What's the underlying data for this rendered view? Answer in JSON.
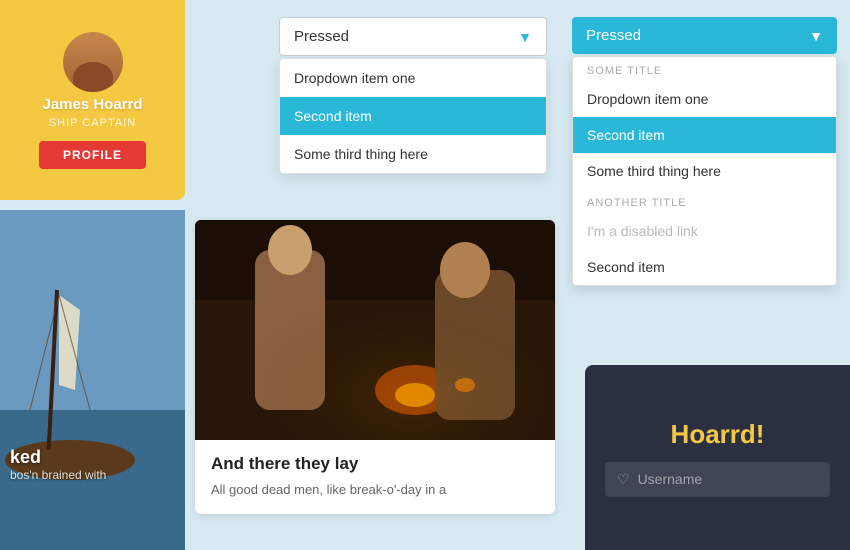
{
  "profile": {
    "name": "James Hoarrd",
    "title": "SHIP CAPTAIN",
    "button_label": "PROFILE"
  },
  "dropdown_simple": {
    "trigger_label": "Pressed",
    "items": [
      {
        "label": "Dropdown item one",
        "active": false
      },
      {
        "label": "Second item",
        "active": true
      },
      {
        "label": "Some third thing here",
        "active": false
      }
    ]
  },
  "dropdown_fancy": {
    "trigger_label": "Pressed",
    "sections": [
      {
        "title": "SOME TITLE",
        "items": [
          {
            "label": "Dropdown item one",
            "active": false,
            "disabled": false
          },
          {
            "label": "Second item",
            "active": true,
            "disabled": false
          },
          {
            "label": "Some third thing here",
            "active": false,
            "disabled": false
          }
        ]
      },
      {
        "title": "ANOTHER TITLE",
        "items": [
          {
            "label": "I'm a disabled link",
            "active": false,
            "disabled": true
          },
          {
            "label": "Second item",
            "active": false,
            "disabled": false
          }
        ]
      }
    ]
  },
  "card2": {
    "title": "And there they lay",
    "text": "All good dead men, like break-o'-day in a"
  },
  "card1": {
    "title": "ked",
    "text": "bos'n brained with"
  },
  "login": {
    "title": "Hoarrd!",
    "username_placeholder": "Username"
  }
}
